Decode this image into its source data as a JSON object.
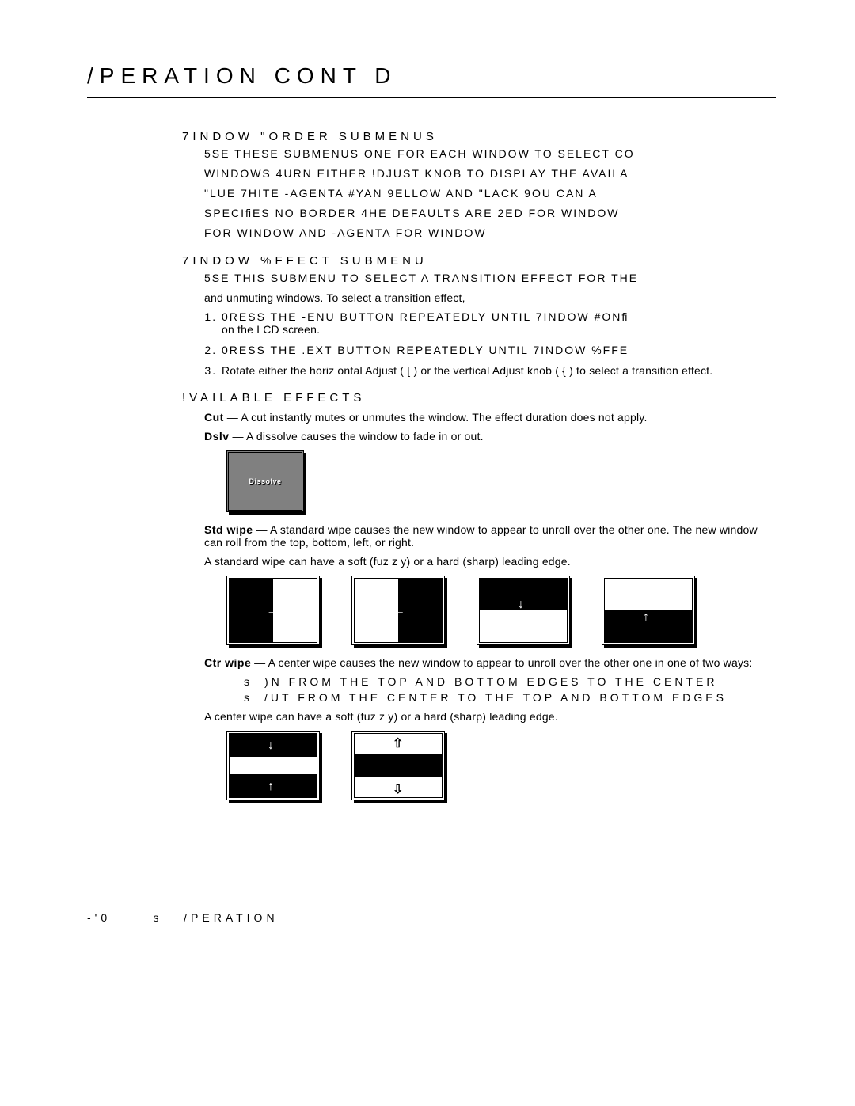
{
  "page_title": "/PERATION CONT D",
  "section1": {
    "heading": "7INDOW \"ORDER SUBMENUS",
    "p1": "5SE THESE SUBMENUS  ONE FOR EACH WINDOW  TO SELECT CO",
    "p2": "WINDOWS   4URN EITHER !DJUST KNOB TO DISPLAY THE AVAILA",
    "p3": "\"LUE 7HITE  -AGENTA  #YAN 9ELLOW AND \"LACK  9OU CAN A",
    "p4": "SPECIﬁES NO BORDER  4HE DEFAULTS ARE 2ED FOR WINDOW",
    "p5": "FOR WINDOW   AND -AGENTA FOR WINDOW"
  },
  "section2": {
    "heading": "7INDOW %FFECT SUBMENU",
    "p1": "5SE THIS SUBMENU TO SELECT A TRANSITION EFFECT FOR THE",
    "p2": "and unmuting windows.  To select a transition effect,",
    "steps": {
      "s1a": "0RESS THE -ENU BUTTON REPEATEDLY UNTIL 7INDOW #ONﬁ",
      "s1b": "on the LCD screen.",
      "s2": "0RESS THE .EXT BUTTON REPEATEDLY UNTIL 7INDOW %FFE",
      "s3": "Rotate either the horiz ontal Adjust (   [   ) or the vertical Adjust knob (     { ) to select a transition effect."
    }
  },
  "section3": {
    "heading": "!VAILABLE EFFECTS",
    "cut": {
      "label": "Cut",
      "text": " — A cut instantly mutes or unmutes the window.  The effect duration does not apply."
    },
    "dissolve": {
      "label": "Dslv",
      "text": " — A dissolve causes the window to fade in or out.",
      "caption": "Dissolve"
    },
    "stdwipe": {
      "label": "Std wipe",
      "text": " — A standard wipe causes the new window to appear to unroll over the other one.  The new window can roll from the top, bottom, left, or right.",
      "note": "A standard wipe can have a soft (fuz z y) or a hard (sharp) leading edge."
    },
    "ctrwipe": {
      "label": "Ctr wipe",
      "text": " — A center wipe causes the new window to appear to unroll over the other one in one of two ways:",
      "b1": ")N FROM THE TOP AND BOTTOM EDGES TO THE CENTER",
      "b2": "/UT FROM THE CENTER TO THE TOP AND BOTTOM EDGES",
      "note": "A center wipe can have a soft (fuz z y) or a hard (sharp) leading edge."
    }
  },
  "footer": {
    "left": "-'0",
    "mid": "s",
    "right": "/PERATION"
  }
}
